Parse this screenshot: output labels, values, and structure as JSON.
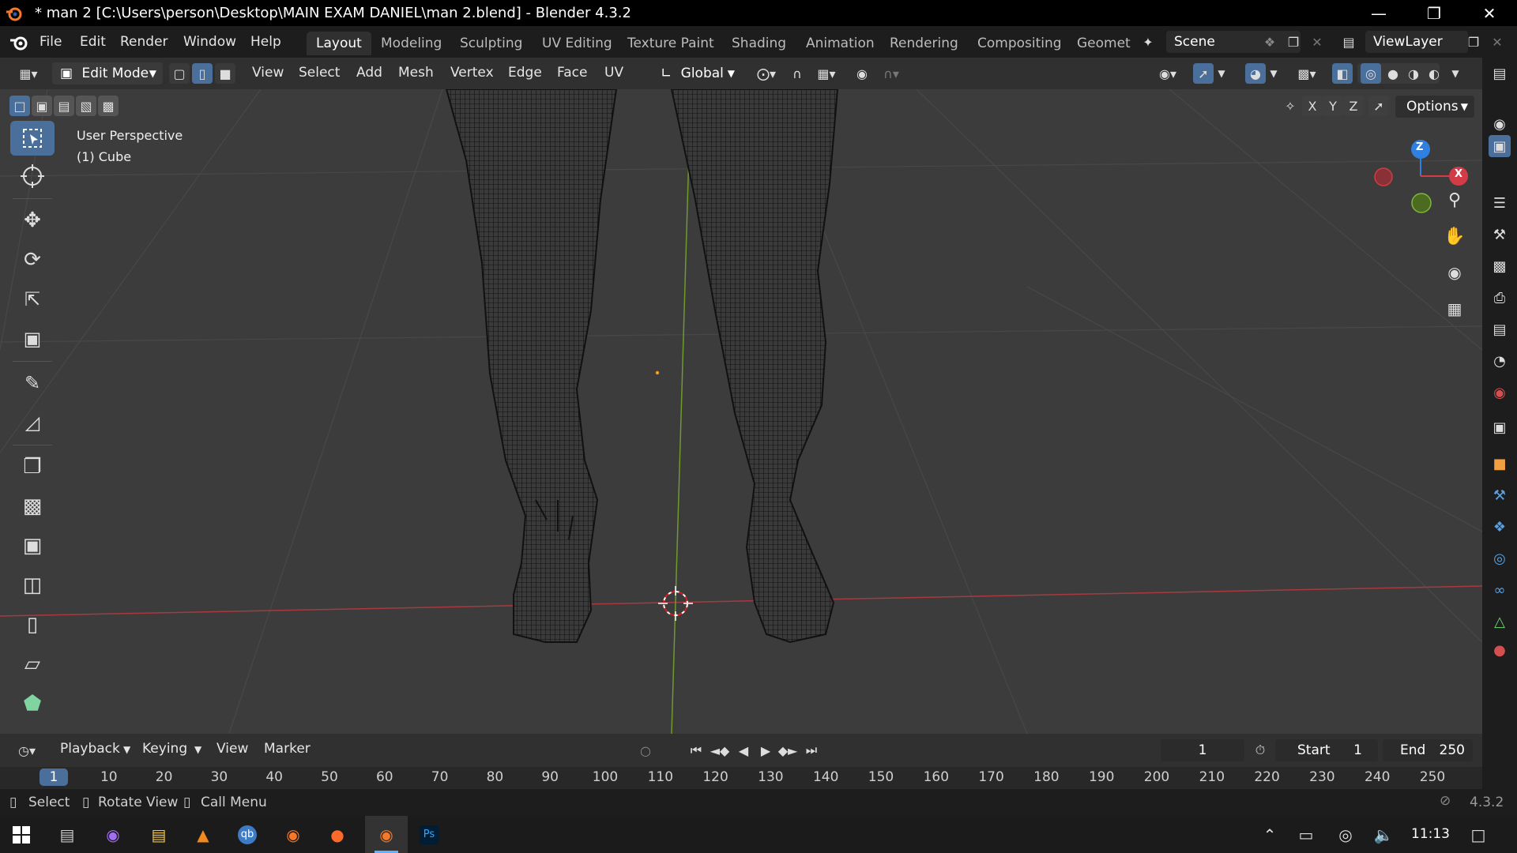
{
  "title_bar": {
    "title": "* man 2 [C:\\Users\\person\\Desktop\\MAIN EXAM DANIEL\\man 2.blend] - Blender 4.3.2"
  },
  "menu": {
    "items": [
      "File",
      "Edit",
      "Render",
      "Window",
      "Help"
    ]
  },
  "workspaces": [
    "Layout",
    "Modeling",
    "Sculpting",
    "UV Editing",
    "Texture Paint",
    "Shading",
    "Animation",
    "Rendering",
    "Compositing",
    "Geomet"
  ],
  "scene": {
    "name": "Scene"
  },
  "view_layer": {
    "name": "ViewLayer"
  },
  "header": {
    "mode": "Edit Mode",
    "menus": [
      "View",
      "Select",
      "Add",
      "Mesh",
      "Vertex",
      "Edge",
      "Face",
      "UV"
    ],
    "transform_orientation": "Global",
    "options_label": "Options",
    "axes": [
      "X",
      "Y",
      "Z"
    ]
  },
  "viewport": {
    "perspective_label": "User Perspective",
    "object_label": "(1) Cube",
    "gizmo": {
      "z": "Z",
      "x": "X"
    },
    "colors": {
      "background": "#3c3c3c",
      "x_axis": "#d33b47",
      "y_axis": "#80b63a",
      "z_axis": "#2f80e0",
      "mesh": "#141414"
    }
  },
  "timeline": {
    "menus": [
      "Playback",
      "Keying",
      "View",
      "Marker"
    ],
    "current_frame": "1",
    "start_label": "Start",
    "start_value": "1",
    "end_label": "End",
    "end_value": "250",
    "ruler": [
      "1",
      "10",
      "20",
      "30",
      "40",
      "50",
      "60",
      "70",
      "80",
      "90",
      "100",
      "110",
      "120",
      "130",
      "140",
      "150",
      "160",
      "170",
      "180",
      "190",
      "200",
      "210",
      "220",
      "230",
      "240",
      "250"
    ]
  },
  "status_bar": {
    "select": "Select",
    "rotate": "Rotate View",
    "call_menu": "Call Menu",
    "version": "4.3.2"
  },
  "taskbar": {
    "time": "11:13",
    "ps_label": "Ps",
    "qb_label": "qb"
  },
  "icons": [
    "blender-logo-icon",
    "minimize-icon",
    "restore-icon",
    "close-icon",
    "select-box-icon",
    "cursor-icon",
    "move-icon",
    "rotate-icon",
    "scale-icon",
    "transform-icon",
    "annotate-icon",
    "measure-icon",
    "add-cube-icon",
    "extrude-icon",
    "inset-icon",
    "bevel-icon",
    "loop-cut-icon",
    "knife-icon",
    "poly-build-icon",
    "zoom-icon",
    "hand-icon",
    "camera-icon",
    "grid-icon",
    "windows-start-icon",
    "firefox-icon",
    "vlc-icon",
    "folder-icon"
  ]
}
